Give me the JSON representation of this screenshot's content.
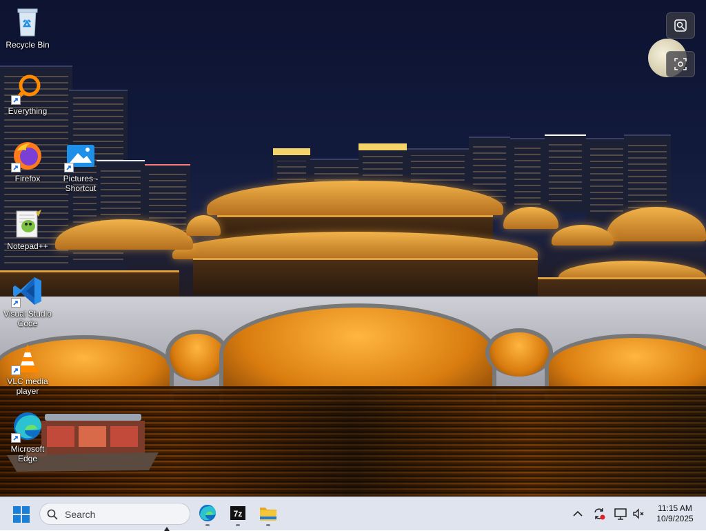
{
  "desktop": {
    "icons": [
      {
        "label": "Recycle Bin",
        "icon": "recycle-bin-icon"
      },
      {
        "label": "Everything",
        "icon": "everything-icon"
      },
      {
        "label": "Firefox",
        "icon": "firefox-icon"
      },
      {
        "label": "Pictures - Shortcut",
        "icon": "pictures-folder-icon"
      },
      {
        "label": "Notepad++",
        "icon": "notepadpp-icon"
      },
      {
        "label": "Visual Studio Code",
        "icon": "vscode-icon"
      },
      {
        "label": "VLC media player",
        "icon": "vlc-icon"
      },
      {
        "label": "Microsoft Edge",
        "icon": "edge-icon"
      }
    ],
    "side_widgets": [
      "visual-search-icon",
      "screenshot-scan-icon"
    ]
  },
  "taskbar": {
    "search_placeholder": "Search",
    "pinned_apps": [
      "edge-icon",
      "7zip-icon",
      "file-explorer-icon"
    ],
    "seven_zip_label": "7z",
    "tray": [
      "chevron-up-icon",
      "sync-icon",
      "network-icon",
      "volume-muted-icon"
    ],
    "clock": {
      "time": "11:15 AM",
      "date": "10/9/2025"
    }
  },
  "colors": {
    "taskbar_bg": "#dfe4ee",
    "windows_blue": "#1a7fd6",
    "edge_blue": "#0f6fc6",
    "folder_yellow": "#f3c53b"
  }
}
